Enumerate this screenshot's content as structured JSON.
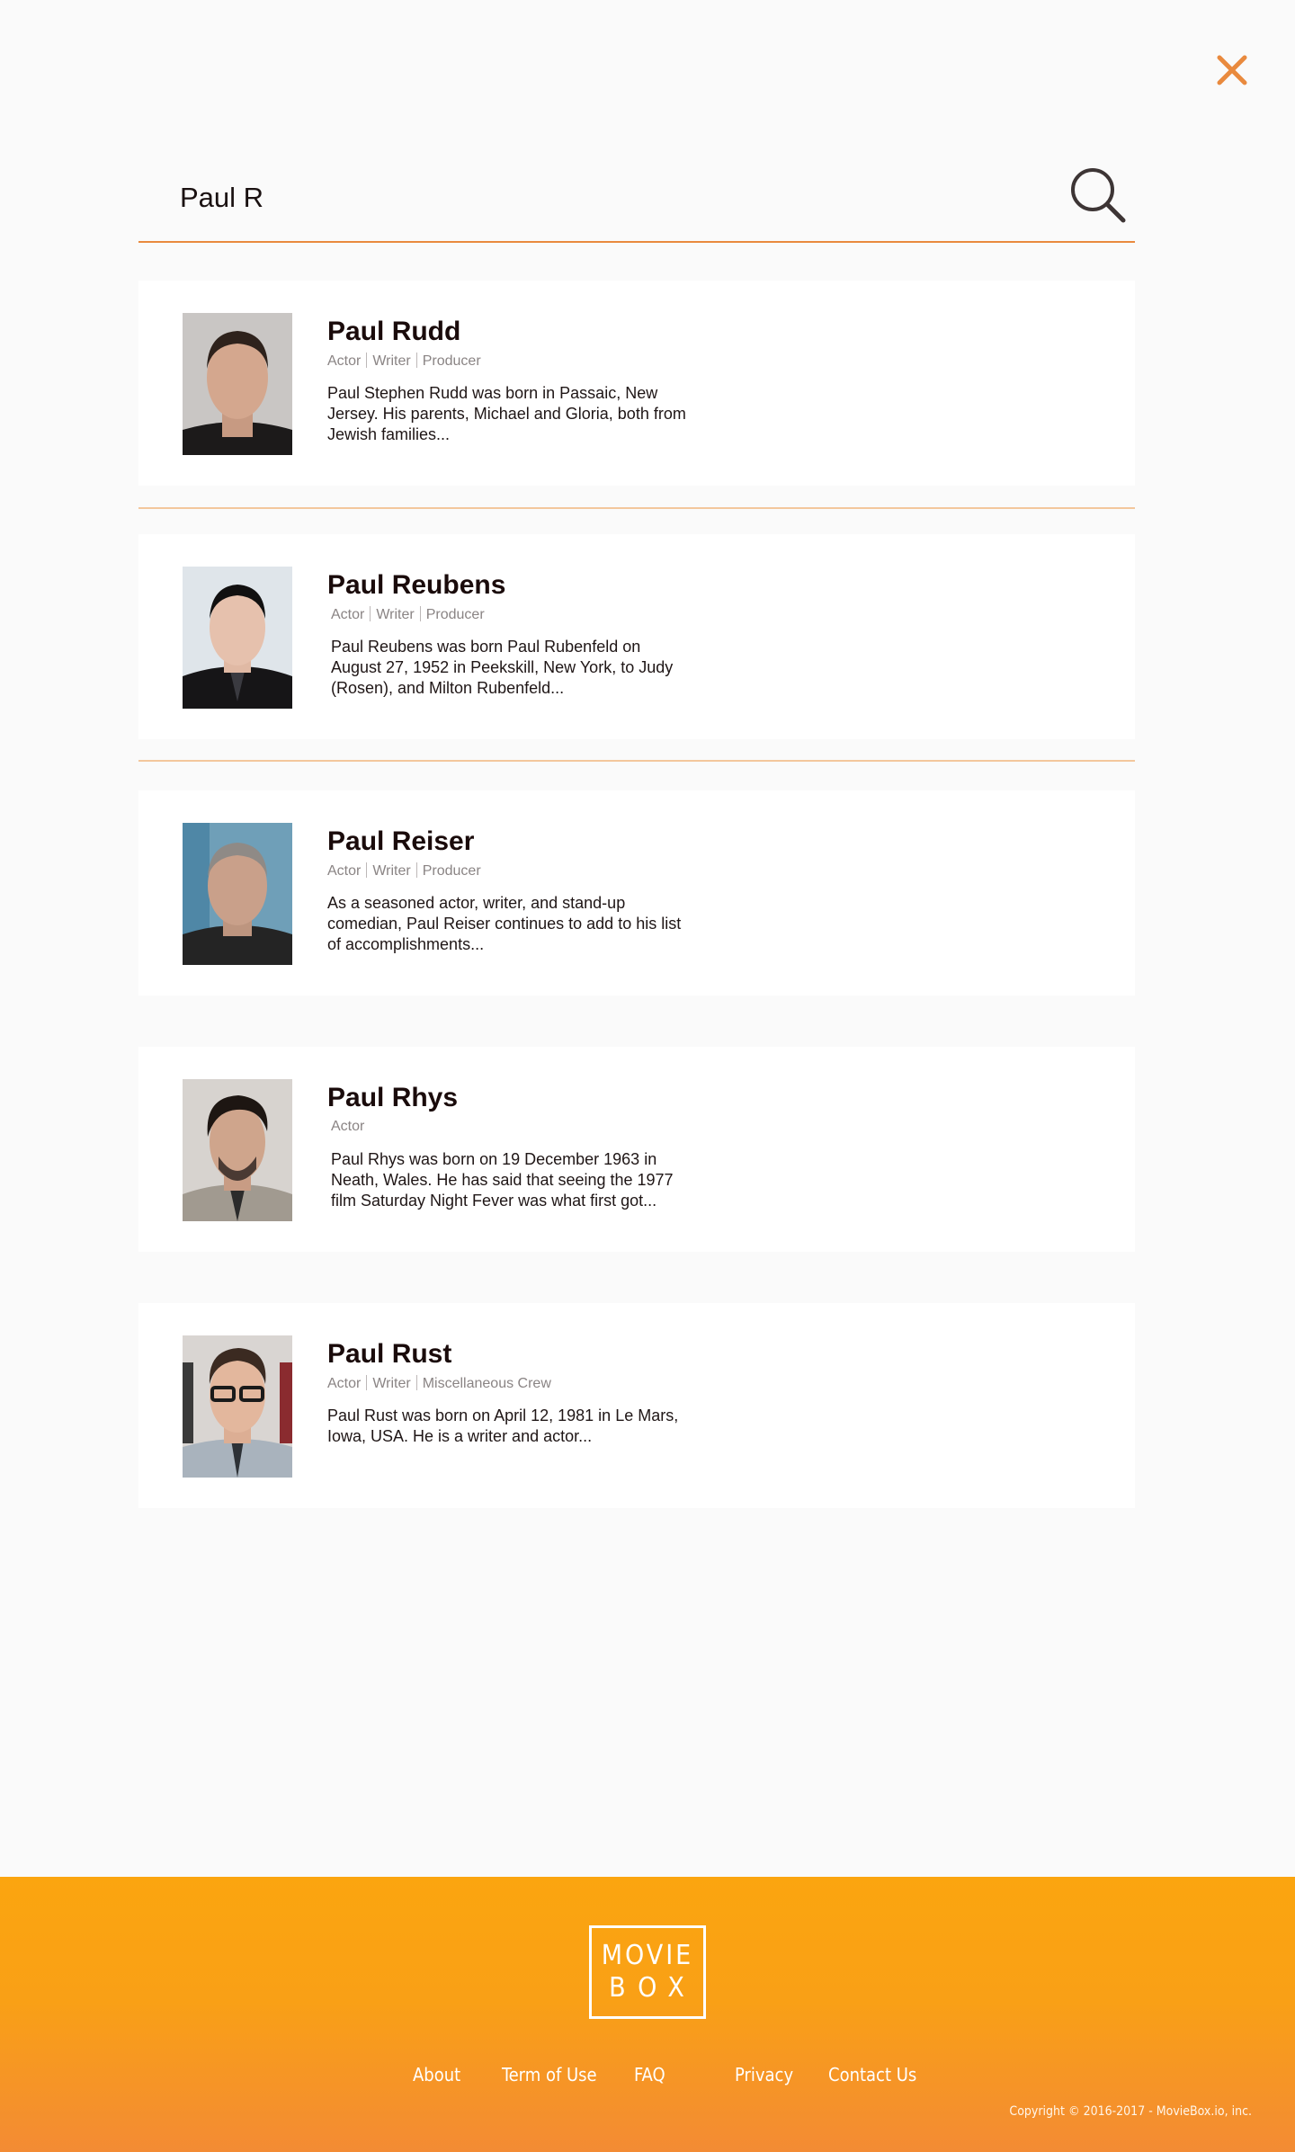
{
  "close_button": {
    "icon": "close-icon",
    "color": "#e98a3e"
  },
  "search": {
    "value": "Paul R",
    "icon": "search-icon"
  },
  "results": [
    {
      "name": "Paul Rudd",
      "roles": [
        "Actor",
        "Writer",
        "Producer"
      ],
      "bio": "Paul Stephen Rudd was born in Passaic, New Jersey. His parents, Michael and Gloria, both from Jewish families..."
    },
    {
      "name": "Paul Reubens",
      "roles": [
        "Actor",
        "Writer",
        "Producer"
      ],
      "bio": "Paul Reubens was born Paul Rubenfeld on August 27, 1952 in Peekskill, New York, to Judy (Rosen), and Milton Rubenfeld..."
    },
    {
      "name": "Paul Reiser",
      "roles": [
        "Actor",
        "Writer",
        "Producer"
      ],
      "bio": "As a seasoned actor, writer, and stand-up comedian, Paul Reiser continues to add to his list of accomplishments..."
    },
    {
      "name": "Paul Rhys",
      "roles": [
        "Actor"
      ],
      "bio": "Paul Rhys was born on 19 December 1963 in Neath, Wales. He has said that seeing the 1977 film Saturday Night Fever was what first got..."
    },
    {
      "name": "Paul Rust",
      "roles": [
        "Actor",
        "Writer",
        "Miscellaneous Crew"
      ],
      "bio": "Paul Rust was born on April 12, 1981 in Le Mars, Iowa, USA. He is a writer and actor..."
    }
  ],
  "footer": {
    "logo": {
      "line1": "MOVIE",
      "line2": "BOX"
    },
    "links": [
      "About",
      "Term of Use",
      "FAQ",
      "Privacy",
      "Contact Us"
    ],
    "copyright": "Copyright © 2016-2017 - MovieBox.io, inc."
  },
  "colors": {
    "accent": "#e98a3e",
    "footer_top": "#fba50f",
    "footer_bottom": "#f38b34"
  }
}
